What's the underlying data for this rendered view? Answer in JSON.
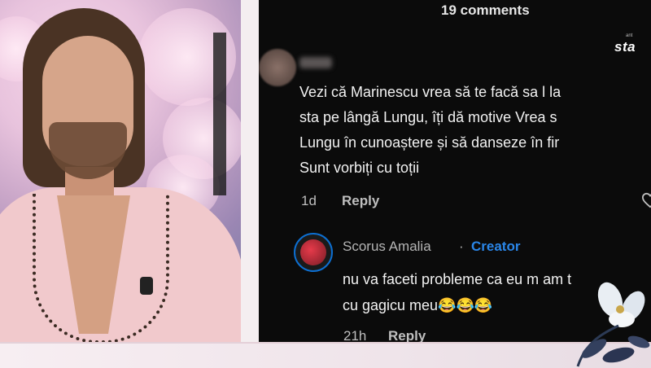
{
  "comments_header": {
    "count_label": "19 comments"
  },
  "watermark": {
    "logo": "sta",
    "sub": "ant"
  },
  "comments": [
    {
      "author": "",
      "lines": [
        "Vezi că Marinescu vrea să te facă sa l la",
        "sta pe lângă Lungu, îți dă motive Vrea s",
        "Lungu în cunoaștere și să danseze în fir",
        "Sunt vorbiți cu toții"
      ],
      "time": "1d",
      "reply_label": "Reply"
    },
    {
      "author": "Scorus Amalia",
      "separator": "·",
      "badge": "Creator",
      "lines": [
        "nu va faceti probleme ca eu m am t",
        "cu gagicu meu😂😂😂"
      ],
      "time": "21h",
      "reply_label": "Reply"
    }
  ],
  "colors": {
    "accent": "#2a86e8",
    "panel": "#0b0b0b",
    "avatar_ring": "#0d6fd1"
  },
  "icons": [
    "heart-icon",
    "flower-decoration"
  ]
}
